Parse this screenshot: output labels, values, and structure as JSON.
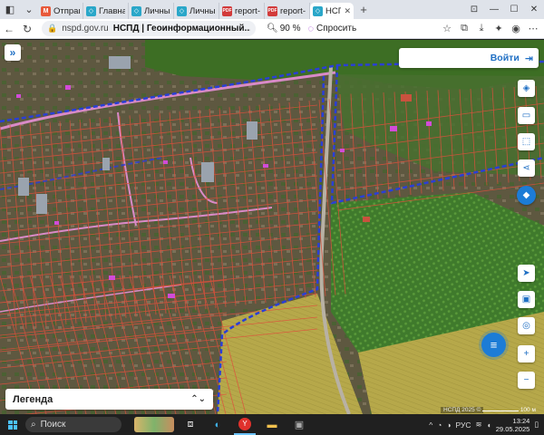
{
  "browser": {
    "tabs": [
      {
        "label": "Отправ",
        "fav_color": "#e8593b",
        "fav_glyph": "M"
      },
      {
        "label": "Главная",
        "fav_color": "#2aa7c9",
        "fav_glyph": "◇"
      },
      {
        "label": "Личный",
        "fav_color": "#2aa7c9",
        "fav_glyph": "◇"
      },
      {
        "label": "Личный",
        "fav_color": "#2aa7c9",
        "fav_glyph": "◇"
      },
      {
        "label": "report-",
        "fav_color": "#d23a3a",
        "fav_glyph": "PDF"
      },
      {
        "label": "report-",
        "fav_color": "#d23a3a",
        "fav_glyph": "PDF"
      },
      {
        "label": "НСПД",
        "fav_color": "#2aa7c9",
        "fav_glyph": "◇",
        "active": true
      }
    ],
    "tab_close": "✕",
    "new_tab": "+",
    "window": {
      "minimize": "—",
      "maximize": "☐",
      "close": "✕"
    },
    "nav": {
      "back": "←",
      "reload": "↻"
    },
    "url": {
      "domain": "nspd.gov.ru",
      "page_title": "НСПД | Геоинформационный..."
    },
    "zoom": "90 %",
    "ask_label": "Спросить"
  },
  "map": {
    "login_label": "Войти",
    "expand_glyph": "»",
    "legend_label": "Легенда",
    "attribution": "НСПД 2025 ©",
    "scale_label": "100 м",
    "chat_glyph": "≡"
  },
  "taskbar": {
    "search_label": "Поиск",
    "lang": "РУС",
    "time": "13:24",
    "date": "29.05.2025"
  },
  "colors": {
    "accent": "#1c7cd6",
    "parcel": "#e0503c",
    "boundary": "#2a3fd6",
    "road": "#d98ac7"
  }
}
